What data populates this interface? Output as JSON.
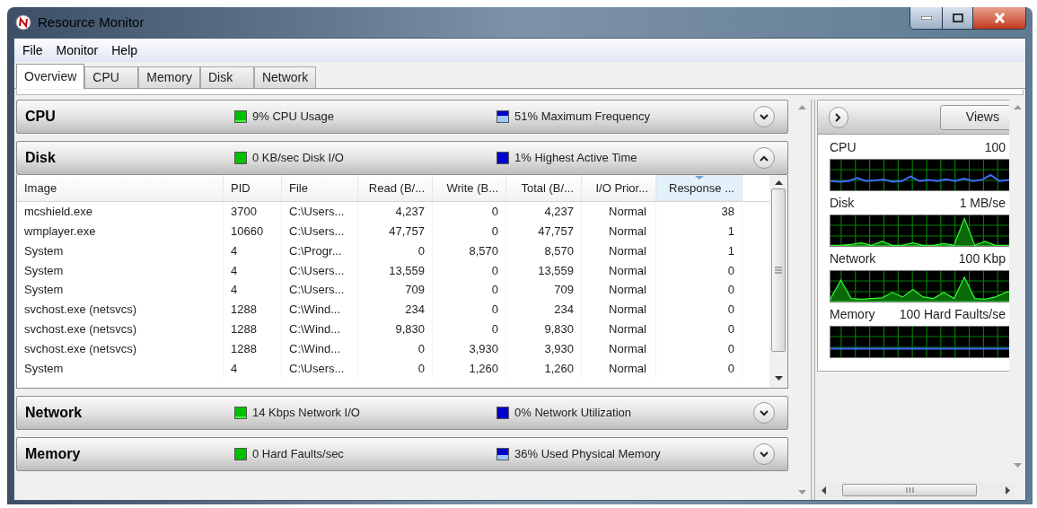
{
  "window": {
    "title": "Resource Monitor"
  },
  "menu": [
    "File",
    "Monitor",
    "Help"
  ],
  "tabs": [
    {
      "label": "Overview",
      "selected": true
    },
    {
      "label": "CPU",
      "selected": false
    },
    {
      "label": "Memory",
      "selected": false
    },
    {
      "label": "Disk",
      "selected": false
    },
    {
      "label": "Network",
      "selected": false
    }
  ],
  "sections": [
    {
      "title": "CPU",
      "expanded": false,
      "indicators": [
        {
          "text": "9% CPU Usage",
          "color": "#00c000"
        },
        {
          "text": "51% Maximum Frequency",
          "color": "#0000d0"
        }
      ]
    },
    {
      "title": "Disk",
      "expanded": true,
      "indicators": [
        {
          "text": "0 KB/sec Disk I/O",
          "color": "#00c000"
        },
        {
          "text": "1% Highest Active Time",
          "color": "#0000d0"
        }
      ],
      "table": {
        "columns": [
          {
            "label": "Image",
            "sorted": false
          },
          {
            "label": "PID",
            "sorted": false
          },
          {
            "label": "File",
            "sorted": false
          },
          {
            "label": "Read (B/...",
            "sorted": false
          },
          {
            "label": "Write (B...",
            "sorted": false
          },
          {
            "label": "Total (B/...",
            "sorted": false
          },
          {
            "label": "I/O Prior...",
            "sorted": false
          },
          {
            "label": "Response ...",
            "sorted": true
          }
        ],
        "rows": [
          [
            "mcshield.exe",
            "3700",
            "C:\\Users...",
            "4,237",
            "0",
            "4,237",
            "Normal",
            "38"
          ],
          [
            "wmplayer.exe",
            "10660",
            "C:\\Users...",
            "47,757",
            "0",
            "47,757",
            "Normal",
            "1"
          ],
          [
            "System",
            "4",
            "C:\\Progr...",
            "0",
            "8,570",
            "8,570",
            "Normal",
            "1"
          ],
          [
            "System",
            "4",
            "C:\\Users...",
            "13,559",
            "0",
            "13,559",
            "Normal",
            "0"
          ],
          [
            "System",
            "4",
            "C:\\Users...",
            "709",
            "0",
            "709",
            "Normal",
            "0"
          ],
          [
            "svchost.exe (netsvcs)",
            "1288",
            "C:\\Wind...",
            "234",
            "0",
            "234",
            "Normal",
            "0"
          ],
          [
            "svchost.exe (netsvcs)",
            "1288",
            "C:\\Wind...",
            "9,830",
            "0",
            "9,830",
            "Normal",
            "0"
          ],
          [
            "svchost.exe (netsvcs)",
            "1288",
            "C:\\Wind...",
            "0",
            "3,930",
            "3,930",
            "Normal",
            "0"
          ],
          [
            "System",
            "4",
            "C:\\Users...",
            "0",
            "1,260",
            "1,260",
            "Normal",
            "0"
          ]
        ]
      }
    },
    {
      "title": "Network",
      "expanded": false,
      "indicators": [
        {
          "text": "14 Kbps Network I/O",
          "color": "#00c000"
        },
        {
          "text": "0% Network Utilization",
          "color": "#0000d0"
        }
      ]
    },
    {
      "title": "Memory",
      "expanded": false,
      "indicators": [
        {
          "text": "0 Hard Faults/sec",
          "color": "#00c000"
        },
        {
          "text": "36% Used Physical Memory",
          "color": "#0000d0"
        }
      ]
    }
  ],
  "graphs_panel": {
    "views_button": "Views",
    "graphs": [
      {
        "label": "CPU",
        "scale": "100"
      },
      {
        "label": "Disk",
        "scale": "1 MB/se"
      },
      {
        "label": "Network",
        "scale": "100 Kbp"
      },
      {
        "label": "Memory",
        "scale": "100 Hard Faults/se"
      }
    ]
  }
}
